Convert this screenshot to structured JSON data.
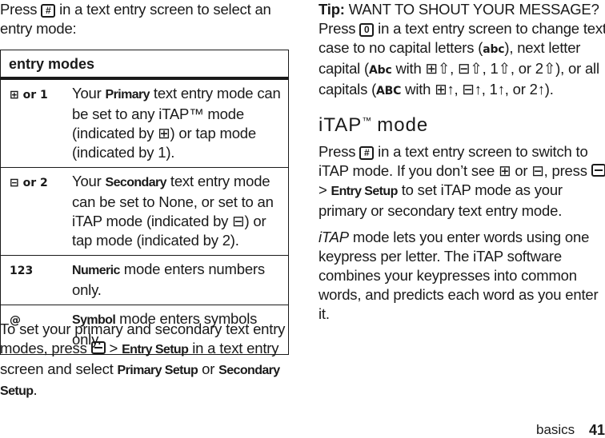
{
  "left": {
    "intro": {
      "before": "Press ",
      "key": "#",
      "after": " in a text entry screen to select an entry mode:"
    },
    "table": {
      "header": "entry modes",
      "rows": [
        {
          "icon": "⊞ or 1",
          "icon_name": "primary-itap-icon",
          "pre": "Your ",
          "bold": "Primary",
          "post": " text entry mode can be set to any iTAP™ mode (indicated by ⊞) or tap mode (indicated by 1)."
        },
        {
          "icon": "⊟ or 2",
          "icon_name": "secondary-itap-icon",
          "pre": "Your ",
          "bold": "Secondary",
          "post": " text entry mode can be set to None, or set to an iTAP mode (indicated by ⊟) or tap mode (indicated by 2)."
        },
        {
          "icon": "123",
          "icon_name": "numeric-icon",
          "pre": "",
          "bold": "Numeric",
          "post": " mode enters numbers only."
        },
        {
          "icon": "@",
          "icon_name": "symbol-icon",
          "pre": "",
          "bold": "Symbol",
          "post": " mode enters symbols only."
        }
      ]
    },
    "setup": {
      "t1": "To set your primary and secondary text entry modes, press ",
      "gt": " > ",
      "b1": "Entry Setup",
      "t2": " in a text entry screen and select ",
      "b2": "Primary Setup",
      "t3": " or ",
      "b3": "Secondary Setup",
      "t4": "."
    }
  },
  "right": {
    "tip": {
      "label": "Tip:",
      "t1": " WANT TO SHOUT YOUR MESSAGE? Press ",
      "key": "0",
      "t2": " in a text entry screen to change text case to no capital letters (",
      "g1": "abc",
      "t3": "), next letter capital (",
      "g2": "Abc",
      "t4": " with ⊞⇧, ⊟⇧, 1⇧, or 2⇧), or all capitals (",
      "g3": "ABC",
      "t5": " with ⊞↑, ⊟↑, 1↑, or 2↑)."
    },
    "section_title": "iTAP",
    "section_tm": "™",
    "section_rest": "mode",
    "itap1": {
      "t1": "Press ",
      "key": "#",
      "t2": " in a text entry screen to switch to iTAP mode. If you don’t see ⊞ or ⊟, press ",
      "gt": " > ",
      "b1": "Entry Setup",
      "t3": " to set iTAP mode as your primary or secondary text entry mode."
    },
    "itap2": {
      "em": "iTAP",
      "t1": " mode lets you enter words using one keypress per letter. The iTAP software combines your keypresses into common words, and predicts each word as you enter it."
    }
  },
  "footer": {
    "section": "basics",
    "page": "41"
  }
}
